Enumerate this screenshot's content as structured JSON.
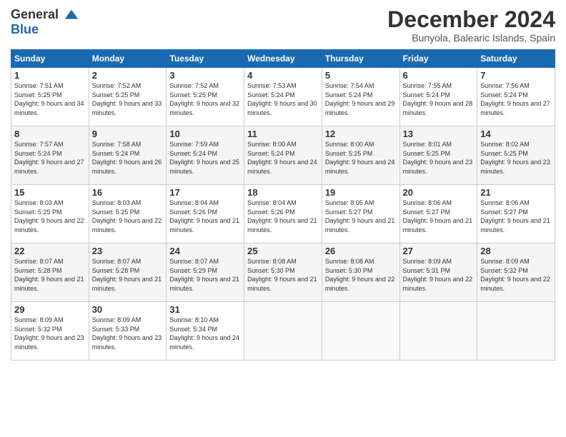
{
  "logo": {
    "general": "General",
    "blue": "Blue"
  },
  "title": "December 2024",
  "subtitle": "Bunyola, Balearic Islands, Spain",
  "headers": [
    "Sunday",
    "Monday",
    "Tuesday",
    "Wednesday",
    "Thursday",
    "Friday",
    "Saturday"
  ],
  "weeks": [
    [
      {
        "day": "1",
        "sunrise": "7:51 AM",
        "sunset": "5:25 PM",
        "daylight": "9 hours and 34 minutes."
      },
      {
        "day": "2",
        "sunrise": "7:52 AM",
        "sunset": "5:25 PM",
        "daylight": "9 hours and 33 minutes."
      },
      {
        "day": "3",
        "sunrise": "7:52 AM",
        "sunset": "5:25 PM",
        "daylight": "9 hours and 32 minutes."
      },
      {
        "day": "4",
        "sunrise": "7:53 AM",
        "sunset": "5:24 PM",
        "daylight": "9 hours and 30 minutes."
      },
      {
        "day": "5",
        "sunrise": "7:54 AM",
        "sunset": "5:24 PM",
        "daylight": "9 hours and 29 minutes."
      },
      {
        "day": "6",
        "sunrise": "7:55 AM",
        "sunset": "5:24 PM",
        "daylight": "9 hours and 28 minutes."
      },
      {
        "day": "7",
        "sunrise": "7:56 AM",
        "sunset": "5:24 PM",
        "daylight": "9 hours and 27 minutes."
      }
    ],
    [
      {
        "day": "8",
        "sunrise": "7:57 AM",
        "sunset": "5:24 PM",
        "daylight": "9 hours and 27 minutes."
      },
      {
        "day": "9",
        "sunrise": "7:58 AM",
        "sunset": "5:24 PM",
        "daylight": "9 hours and 26 minutes."
      },
      {
        "day": "10",
        "sunrise": "7:59 AM",
        "sunset": "5:24 PM",
        "daylight": "9 hours and 25 minutes."
      },
      {
        "day": "11",
        "sunrise": "8:00 AM",
        "sunset": "5:24 PM",
        "daylight": "9 hours and 24 minutes."
      },
      {
        "day": "12",
        "sunrise": "8:00 AM",
        "sunset": "5:25 PM",
        "daylight": "9 hours and 24 minutes."
      },
      {
        "day": "13",
        "sunrise": "8:01 AM",
        "sunset": "5:25 PM",
        "daylight": "9 hours and 23 minutes."
      },
      {
        "day": "14",
        "sunrise": "8:02 AM",
        "sunset": "5:25 PM",
        "daylight": "9 hours and 23 minutes."
      }
    ],
    [
      {
        "day": "15",
        "sunrise": "8:03 AM",
        "sunset": "5:25 PM",
        "daylight": "9 hours and 22 minutes."
      },
      {
        "day": "16",
        "sunrise": "8:03 AM",
        "sunset": "5:25 PM",
        "daylight": "9 hours and 22 minutes."
      },
      {
        "day": "17",
        "sunrise": "8:04 AM",
        "sunset": "5:26 PM",
        "daylight": "9 hours and 21 minutes."
      },
      {
        "day": "18",
        "sunrise": "8:04 AM",
        "sunset": "5:26 PM",
        "daylight": "9 hours and 21 minutes."
      },
      {
        "day": "19",
        "sunrise": "8:05 AM",
        "sunset": "5:27 PM",
        "daylight": "9 hours and 21 minutes."
      },
      {
        "day": "20",
        "sunrise": "8:06 AM",
        "sunset": "5:27 PM",
        "daylight": "9 hours and 21 minutes."
      },
      {
        "day": "21",
        "sunrise": "8:06 AM",
        "sunset": "5:27 PM",
        "daylight": "9 hours and 21 minutes."
      }
    ],
    [
      {
        "day": "22",
        "sunrise": "8:07 AM",
        "sunset": "5:28 PM",
        "daylight": "9 hours and 21 minutes."
      },
      {
        "day": "23",
        "sunrise": "8:07 AM",
        "sunset": "5:28 PM",
        "daylight": "9 hours and 21 minutes."
      },
      {
        "day": "24",
        "sunrise": "8:07 AM",
        "sunset": "5:29 PM",
        "daylight": "9 hours and 21 minutes."
      },
      {
        "day": "25",
        "sunrise": "8:08 AM",
        "sunset": "5:30 PM",
        "daylight": "9 hours and 21 minutes."
      },
      {
        "day": "26",
        "sunrise": "8:08 AM",
        "sunset": "5:30 PM",
        "daylight": "9 hours and 22 minutes."
      },
      {
        "day": "27",
        "sunrise": "8:09 AM",
        "sunset": "5:31 PM",
        "daylight": "9 hours and 22 minutes."
      },
      {
        "day": "28",
        "sunrise": "8:09 AM",
        "sunset": "5:32 PM",
        "daylight": "9 hours and 22 minutes."
      }
    ],
    [
      {
        "day": "29",
        "sunrise": "8:09 AM",
        "sunset": "5:32 PM",
        "daylight": "9 hours and 23 minutes."
      },
      {
        "day": "30",
        "sunrise": "8:09 AM",
        "sunset": "5:33 PM",
        "daylight": "9 hours and 23 minutes."
      },
      {
        "day": "31",
        "sunrise": "8:10 AM",
        "sunset": "5:34 PM",
        "daylight": "9 hours and 24 minutes."
      },
      null,
      null,
      null,
      null
    ]
  ]
}
